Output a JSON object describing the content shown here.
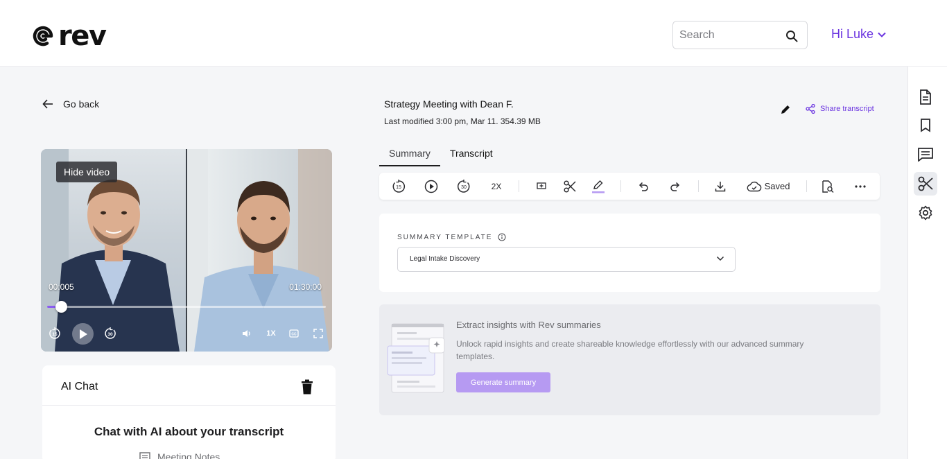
{
  "header": {
    "logo_text": "rev",
    "search_placeholder": "Search",
    "greeting": "Hi Luke"
  },
  "nav": {
    "go_back": "Go back"
  },
  "video": {
    "hide_label": "Hide video",
    "current_time": "00:005",
    "duration": "01:30:00",
    "progress_fraction": 0.05,
    "rewind_label": "15",
    "forward_label": "30",
    "speed": "1X",
    "cc_label": "CC"
  },
  "chat": {
    "title": "AI Chat",
    "heading": "Chat with AI about your transcript",
    "sub_item": "Meeting Notes"
  },
  "document": {
    "title": "Strategy Meeting with Dean F.",
    "meta": "Last modified 3:00 pm, Mar 11. 354.39 MB",
    "share_label": "Share transcript"
  },
  "tabs": [
    {
      "label": "Summary",
      "active": true
    },
    {
      "label": "Transcript",
      "active": false
    }
  ],
  "toolbar": {
    "rewind_label": "15",
    "forward_label": "30",
    "speed": "2X",
    "saved_label": "Saved"
  },
  "template": {
    "label": "SUMMARY TEMPLATE",
    "selected": "Legal Intake Discovery"
  },
  "insights": {
    "title": "Extract insights with Rev summaries",
    "description": "Unlock rapid insights and create shareable knowledge effortlessly with our advanced summary templates.",
    "button": "Generate summary"
  },
  "colors": {
    "accent": "#6a33e0",
    "button_bg": "#b69af2",
    "progress": "#8a5cf0"
  }
}
